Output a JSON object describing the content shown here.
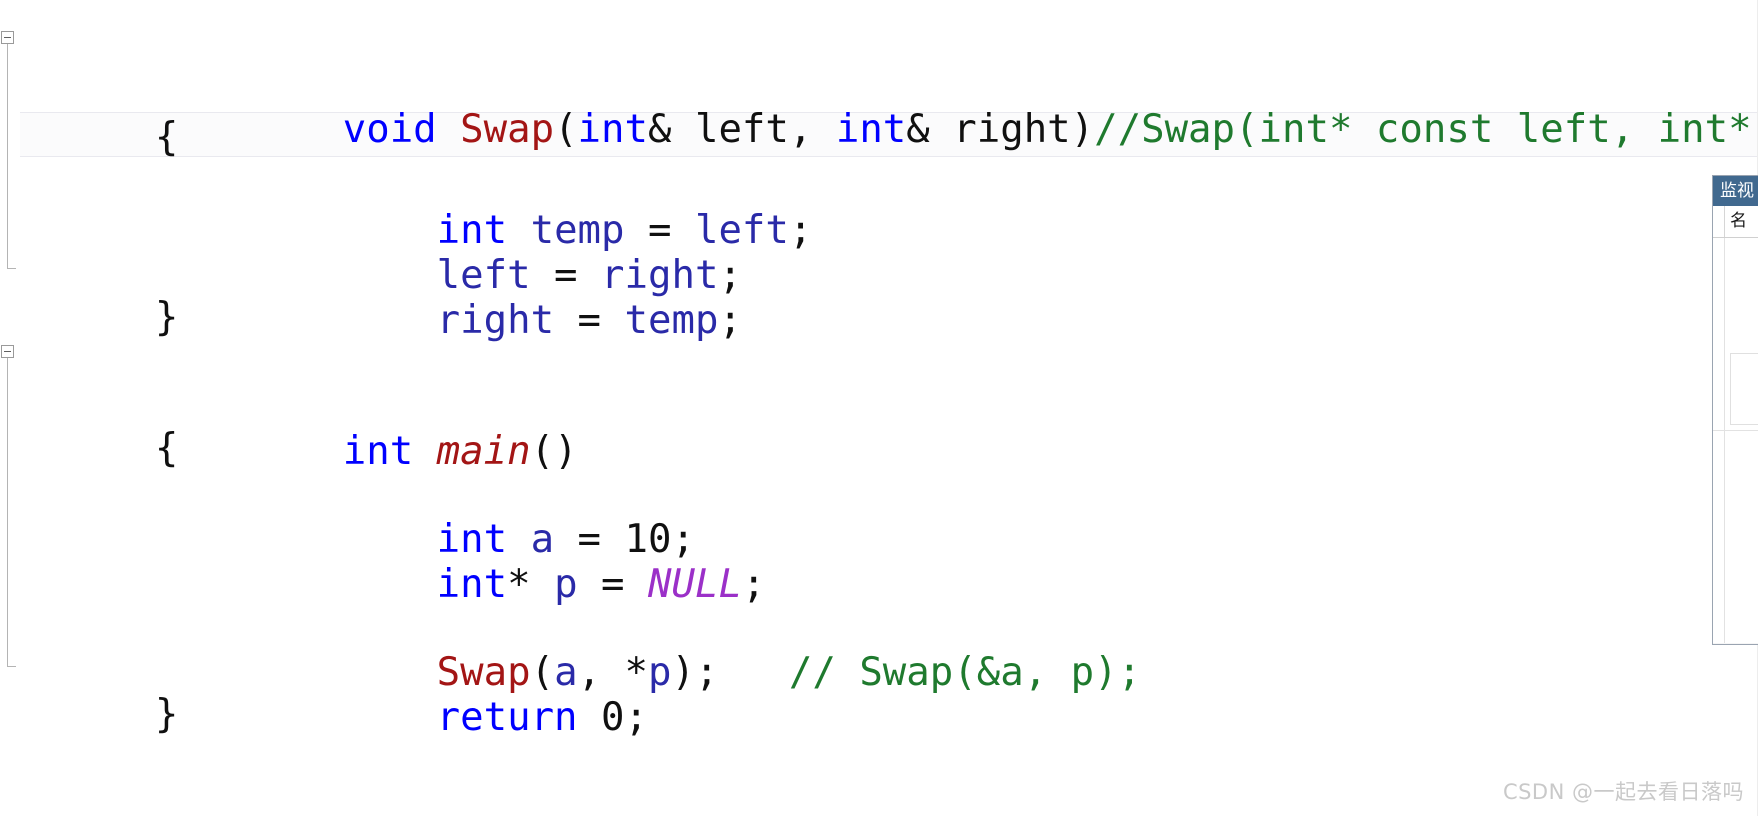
{
  "editor": {
    "language": "C++",
    "background_color": "#ffffff",
    "current_line_highlight_color": "#fbfbfc",
    "token_colors": {
      "keyword": "#0000ff",
      "function": "#a31515",
      "comment": "#1f7a2e",
      "macro": "#9b30c8",
      "plain": "#101010",
      "variable": "#2a2aa8"
    },
    "lines": [
      {
        "index": 0,
        "has_collapse_box": true,
        "is_current_line": false,
        "segments": [
          {
            "text": "void ",
            "kind": "keyword"
          },
          {
            "text": "Swap",
            "kind": "function"
          },
          {
            "text": "(",
            "kind": "plain"
          },
          {
            "text": "int",
            "kind": "keyword"
          },
          {
            "text": "& left, ",
            "kind": "plain"
          },
          {
            "text": "int",
            "kind": "keyword"
          },
          {
            "text": "& right)",
            "kind": "plain"
          },
          {
            "text": "//Swap(int* const left, int* const right)",
            "kind": "comment"
          }
        ]
      },
      {
        "index": 1,
        "has_collapse_box": false,
        "is_current_line": false,
        "segments": [
          {
            "text": "{",
            "kind": "plain"
          }
        ]
      },
      {
        "index": 2,
        "has_collapse_box": false,
        "is_current_line": true,
        "segments": [
          {
            "text": "    ",
            "kind": "plain"
          },
          {
            "text": "int",
            "kind": "keyword"
          },
          {
            "text": " ",
            "kind": "plain"
          },
          {
            "text": "temp",
            "kind": "variable"
          },
          {
            "text": " = ",
            "kind": "plain"
          },
          {
            "text": "left",
            "kind": "variable"
          },
          {
            "text": ";",
            "kind": "plain"
          }
        ]
      },
      {
        "index": 3,
        "has_collapse_box": false,
        "is_current_line": false,
        "segments": [
          {
            "text": "    ",
            "kind": "plain"
          },
          {
            "text": "left",
            "kind": "variable"
          },
          {
            "text": " = ",
            "kind": "plain"
          },
          {
            "text": "right",
            "kind": "variable"
          },
          {
            "text": ";",
            "kind": "plain"
          }
        ]
      },
      {
        "index": 4,
        "has_collapse_box": false,
        "is_current_line": false,
        "segments": [
          {
            "text": "    ",
            "kind": "plain"
          },
          {
            "text": "right",
            "kind": "variable"
          },
          {
            "text": " = ",
            "kind": "plain"
          },
          {
            "text": "temp",
            "kind": "variable"
          },
          {
            "text": ";",
            "kind": "plain"
          }
        ]
      },
      {
        "index": 5,
        "has_collapse_box": false,
        "is_current_line": false,
        "segments": [
          {
            "text": "}",
            "kind": "plain"
          }
        ]
      },
      {
        "index": 6,
        "has_collapse_box": false,
        "is_current_line": false,
        "segments": [
          {
            "text": "",
            "kind": "plain"
          }
        ]
      },
      {
        "index": 7,
        "has_collapse_box": true,
        "is_current_line": false,
        "segments": [
          {
            "text": "int",
            "kind": "keyword"
          },
          {
            "text": " ",
            "kind": "plain"
          },
          {
            "text": "main",
            "kind": "function-italic"
          },
          {
            "text": "()",
            "kind": "plain"
          }
        ]
      },
      {
        "index": 8,
        "has_collapse_box": false,
        "is_current_line": false,
        "segments": [
          {
            "text": "{",
            "kind": "plain"
          }
        ]
      },
      {
        "index": 9,
        "has_collapse_box": false,
        "is_current_line": false,
        "segments": [
          {
            "text": "",
            "kind": "plain"
          }
        ]
      },
      {
        "index": 10,
        "has_collapse_box": false,
        "is_current_line": false,
        "segments": [
          {
            "text": "    ",
            "kind": "plain"
          },
          {
            "text": "int",
            "kind": "keyword"
          },
          {
            "text": " ",
            "kind": "plain"
          },
          {
            "text": "a",
            "kind": "variable"
          },
          {
            "text": " = ",
            "kind": "plain"
          },
          {
            "text": "10",
            "kind": "number"
          },
          {
            "text": ";",
            "kind": "plain"
          }
        ]
      },
      {
        "index": 11,
        "has_collapse_box": false,
        "is_current_line": false,
        "segments": [
          {
            "text": "    ",
            "kind": "plain"
          },
          {
            "text": "int",
            "kind": "keyword"
          },
          {
            "text": "* ",
            "kind": "plain"
          },
          {
            "text": "p",
            "kind": "variable"
          },
          {
            "text": " = ",
            "kind": "plain"
          },
          {
            "text": "NULL",
            "kind": "macro"
          },
          {
            "text": ";",
            "kind": "plain"
          }
        ]
      },
      {
        "index": 12,
        "has_collapse_box": false,
        "is_current_line": false,
        "segments": [
          {
            "text": "",
            "kind": "plain"
          }
        ]
      },
      {
        "index": 13,
        "has_collapse_box": false,
        "is_current_line": false,
        "segments": [
          {
            "text": "    ",
            "kind": "plain"
          },
          {
            "text": "Swap",
            "kind": "function"
          },
          {
            "text": "(",
            "kind": "plain"
          },
          {
            "text": "a",
            "kind": "variable"
          },
          {
            "text": ", *",
            "kind": "plain"
          },
          {
            "text": "p",
            "kind": "variable"
          },
          {
            "text": ");   ",
            "kind": "plain"
          },
          {
            "text": "// Swap(&a, p);",
            "kind": "comment"
          }
        ]
      },
      {
        "index": 14,
        "has_collapse_box": false,
        "is_current_line": false,
        "segments": [
          {
            "text": "    ",
            "kind": "plain"
          },
          {
            "text": "return",
            "kind": "keyword"
          },
          {
            "text": " ",
            "kind": "plain"
          },
          {
            "text": "0",
            "kind": "number"
          },
          {
            "text": ";",
            "kind": "plain"
          }
        ]
      },
      {
        "index": 15,
        "has_collapse_box": false,
        "is_current_line": false,
        "segments": [
          {
            "text": "}",
            "kind": "plain"
          }
        ]
      }
    ]
  },
  "watch_window": {
    "title": "监视",
    "columns": [
      "名"
    ],
    "rows": []
  },
  "watermark": {
    "text": "CSDN @一起去看日落吗",
    "color": "#c9c9c9"
  }
}
